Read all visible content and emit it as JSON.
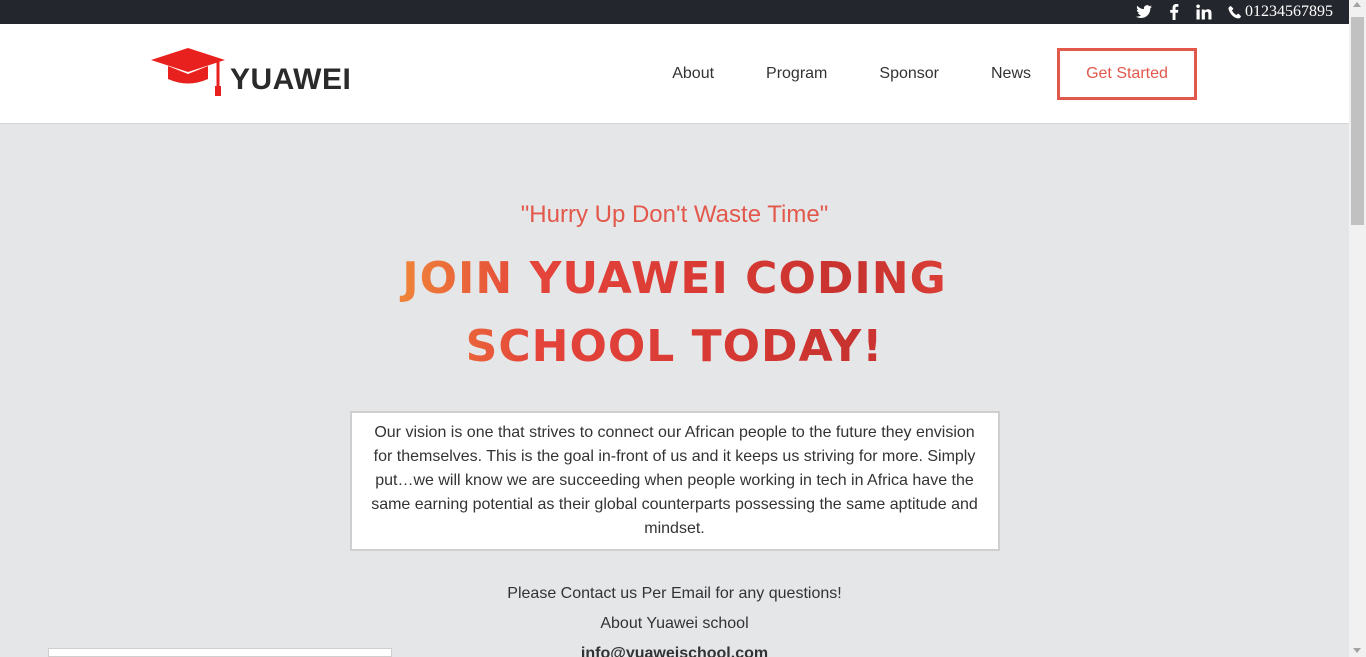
{
  "topbar": {
    "icons": [
      "twitter-icon",
      "facebook-icon",
      "linkedin-icon",
      "phone-icon"
    ],
    "phone": "01234567895"
  },
  "header": {
    "logo_text": "YUAWEI",
    "nav": [
      "About",
      "Program",
      "Sponsor",
      "News"
    ],
    "cta": "Get Started"
  },
  "hero": {
    "quote": "\"Hurry Up Don't Waste Time\"",
    "headline_line1": "JOIN YUAWEI CODING",
    "headline_line2": "SCHOOL TODAY!",
    "vision": "Our vision is one that strives to connect our African people to the future they envision for themselves. This is the goal in-front of us and it keeps us striving for more. Simply put…we will know we are succeeding when people working in tech in Africa have the same earning potential as their global counterparts possessing the same aptitude and mindset.",
    "contact_line": "Please Contact us Per Email for any questions!",
    "about_line": "About Yuawei school",
    "email": "info@yuaweischool.com"
  },
  "colors": {
    "accent": "#e2584b",
    "topbar_bg": "#24262d",
    "page_bg": "#e5e6e8"
  }
}
